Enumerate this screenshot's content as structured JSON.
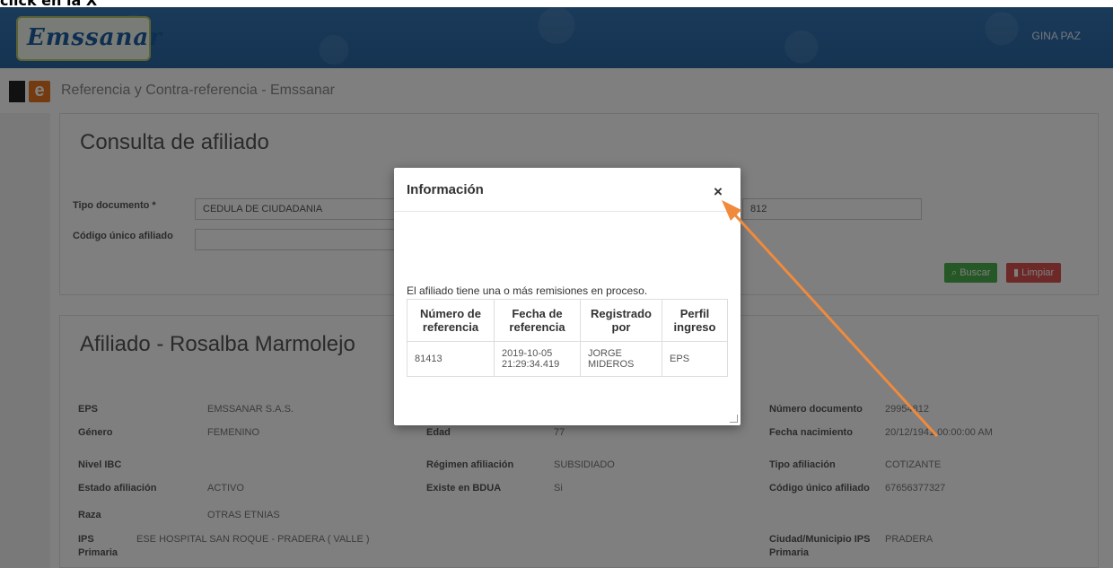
{
  "instruction": "click en la X",
  "header": {
    "logo_text": "Emssanar",
    "user_name": "GINA PAZ"
  },
  "subbar": {
    "icon_letter": "e",
    "title": "Referencia y Contra-referencia - Emssanar"
  },
  "consulta": {
    "title": "Consulta de afiliado",
    "tipo_documento_label": "Tipo documento *",
    "tipo_documento_value": "CEDULA DE CIUDADANIA",
    "codigo_label": "Código único afiliado",
    "codigo_value": "",
    "numero_partial": "812",
    "buscar_label": "Buscar",
    "limpiar_label": "Limpiar"
  },
  "afiliado": {
    "title": "Afiliado - Rosalba Marmolejo",
    "fields": {
      "eps_label": "EPS",
      "eps_value": "EMSSANAR S.A.S.",
      "genero_label": "Género",
      "genero_value": "FEMENINO",
      "nivel_label": "Nivel IBC",
      "nivel_value": "",
      "estado_label": "Estado afiliación",
      "estado_value": "ACTIVO",
      "raza_label": "Raza",
      "raza_value": "OTRAS ETNIAS",
      "ips_label_1": "IPS",
      "ips_label_2": "Primaria",
      "ips_value": "ESE HOSPITAL SAN ROQUE - PRADERA ( VALLE )",
      "edad_label": "Edad",
      "edad_value": "77",
      "regimen_label": "Régimen afiliación",
      "regimen_value": "SUBSIDIADO",
      "bdua_label": "Existe en BDUA",
      "bdua_value": "Si",
      "numdoc_label": "Número documento",
      "numdoc_value": "29954812",
      "fecha_label": "Fecha nacimiento",
      "fecha_value": "20/12/1941 00:00:00 AM",
      "tipoafil_label": "Tipo afiliación",
      "tipoafil_value": "COTIZANTE",
      "codigo_label": "Código único afiliado",
      "codigo_value": "67656377327",
      "ciudad_label_1": "Ciudad/Municipio IPS",
      "ciudad_label_2": "Primaria",
      "ciudad_value": "PRADERA"
    }
  },
  "modal": {
    "title": "Información",
    "close_symbol": "×",
    "message": "El afiliado tiene una o más remisiones en proceso.",
    "headers": [
      "Número de referencia",
      "Fecha de referencia",
      "Registrado por",
      "Perfil ingreso"
    ],
    "rows": [
      [
        "81413",
        "2019-10-05 21:29:34.419",
        "JORGE MIDEROS",
        "EPS"
      ]
    ]
  },
  "colors": {
    "header_blue": "#2b6aa8",
    "accent_orange": "#e87722",
    "button_green": "#4cae4c",
    "button_red": "#d9534f"
  }
}
